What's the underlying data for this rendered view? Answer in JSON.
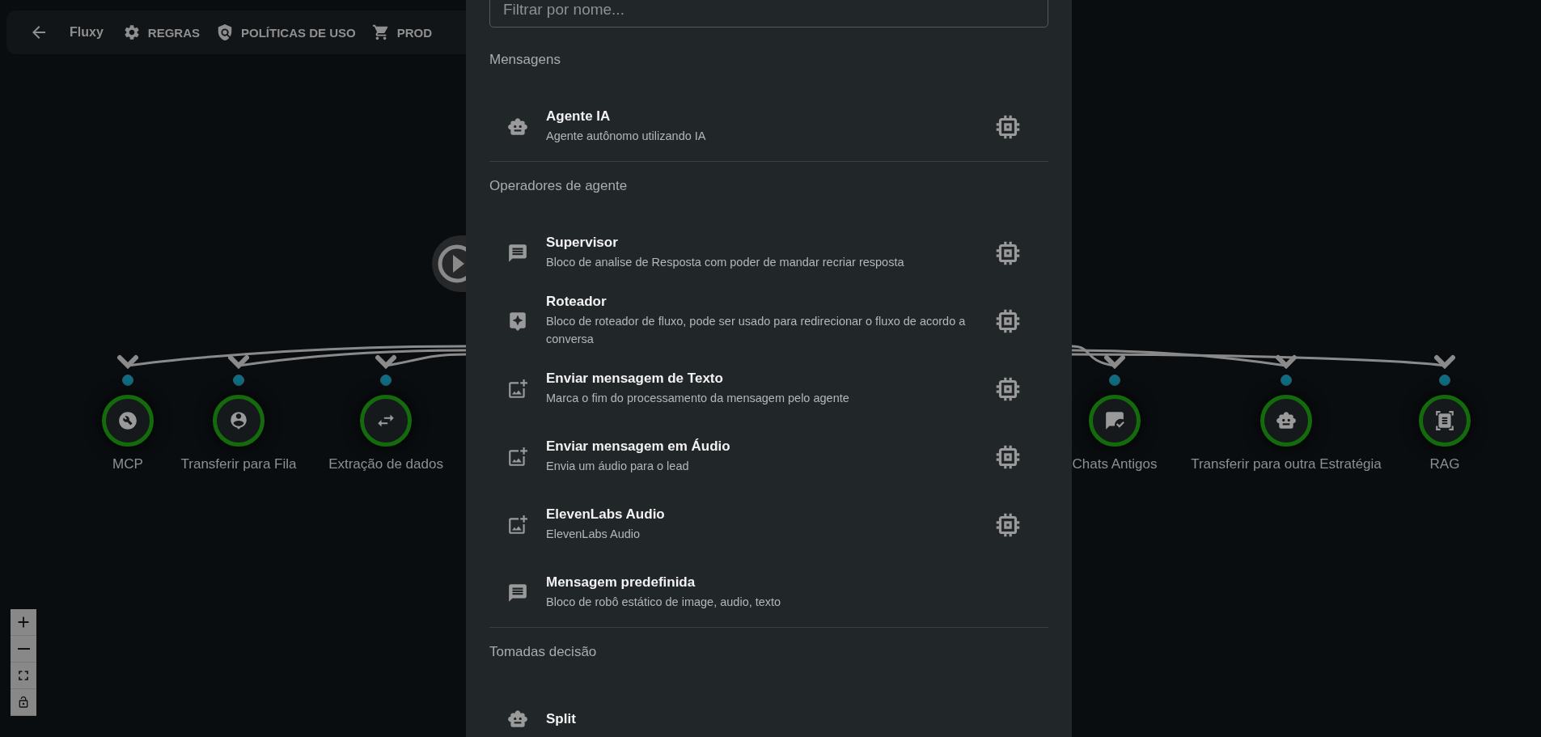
{
  "toolbar": {
    "title": "Fluxy",
    "items": [
      {
        "kind": "rules",
        "label": "REGRAS"
      },
      {
        "kind": "policy",
        "label": "POLÍTICAS DE USO"
      },
      {
        "kind": "cart",
        "label": "PROD"
      }
    ]
  },
  "canvas": {
    "nodes": [
      {
        "kind": "tool",
        "label": "MCP"
      },
      {
        "kind": "queue",
        "label": "Transferir para Fila"
      },
      {
        "kind": "extract",
        "label": "Extração de dados"
      },
      {
        "kind": "chats",
        "label": "Chats Antigos"
      },
      {
        "kind": "bot",
        "label": "Transferir para outra Estratégia"
      },
      {
        "kind": "rag",
        "label": "RAG"
      }
    ]
  },
  "panel": {
    "search": {
      "placeholder": "Filtrar por nome..."
    },
    "sections": [
      {
        "title": "Mensagens",
        "items": [
          {
            "kind": "agent",
            "title": "Agente IA",
            "description": "Agente autônomo utilizando IA",
            "uses_model": true
          }
        ]
      },
      {
        "title": "Operadores de agente",
        "items": [
          {
            "kind": "chat",
            "title": "Supervisor",
            "description": "Bloco de analise de Resposta com poder de mandar recriar resposta",
            "uses_model": true
          },
          {
            "kind": "router",
            "title": "Roteador",
            "description": "Bloco de roteador de fluxo, pode ser usado para redirecionar o fluxo de acordo a conversa",
            "uses_model": true
          },
          {
            "kind": "send",
            "title": "Enviar mensagem de Texto",
            "description": "Marca o fim do processamento da mensagem pelo agente",
            "uses_model": true
          },
          {
            "kind": "send",
            "title": "Enviar mensagem em Áudio",
            "description": "Envia um áudio para o lead",
            "uses_model": true
          },
          {
            "kind": "send",
            "title": "ElevenLabs Audio",
            "description": "ElevenLabs Audio",
            "uses_model": true
          },
          {
            "kind": "chat",
            "title": "Mensagem predefinida",
            "description": "Bloco de robô estático de image, audio, texto",
            "uses_model": false
          }
        ]
      },
      {
        "title": "Tomadas decisão",
        "items": [
          {
            "kind": "agent",
            "title": "Split"
          }
        ]
      }
    ]
  }
}
